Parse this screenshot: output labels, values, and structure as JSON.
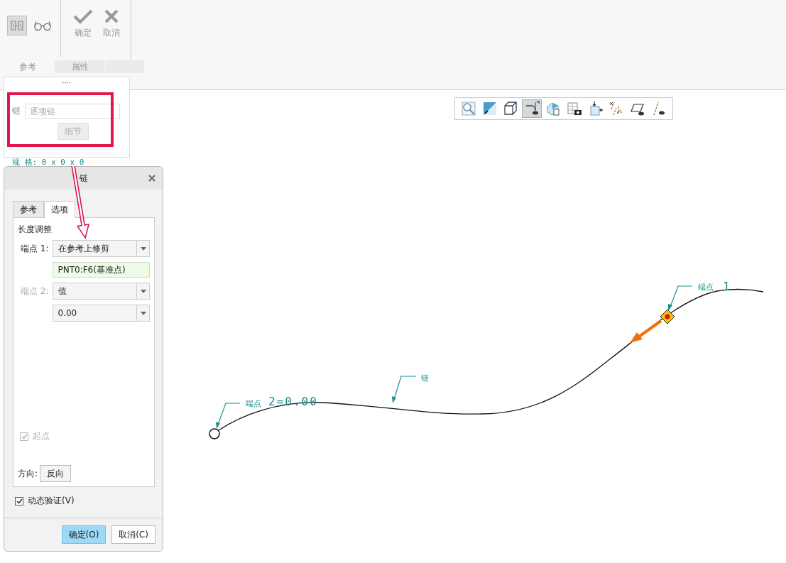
{
  "ribbon": {
    "tools": [
      {
        "kind": "chain-box",
        "selected": true
      },
      {
        "kind": "glasses",
        "selected": false
      }
    ],
    "actions": [
      {
        "kind": "ok",
        "label": "确定"
      },
      {
        "kind": "cancel",
        "label": "取消"
      }
    ],
    "tabs": [
      {
        "label": "参考",
        "selected": true
      },
      {
        "label": "属性",
        "selected": false
      }
    ]
  },
  "popup": {
    "label": "链",
    "placeholder": "逐项链",
    "button": "细节",
    "button_disabled": true
  },
  "spec_text": "规 格: 0 x 0 x 0",
  "dialog": {
    "title": "链",
    "tabs": [
      {
        "label": "参考",
        "selected": false
      },
      {
        "label": "选项",
        "selected": true
      }
    ],
    "section": "长度调整",
    "rows": [
      {
        "kind": "select",
        "label": "端点 1:",
        "label_disabled": false,
        "value": "在参考上修剪"
      },
      {
        "kind": "reference",
        "value": "PNT0:F6(基准点)"
      },
      {
        "kind": "select",
        "label": "端点 2:",
        "label_disabled": true,
        "value": "值"
      },
      {
        "kind": "select",
        "value": "0.00"
      }
    ],
    "start_point": {
      "label": "起点",
      "checked": true,
      "disabled": true
    },
    "direction": {
      "label": "方向:",
      "button": "反向"
    },
    "dynamic": {
      "label": "动态验证(V)",
      "checked": true
    },
    "buttons": [
      {
        "label": "确定(O)",
        "primary": true
      },
      {
        "label": "取消(C)",
        "primary": false
      }
    ]
  },
  "view_toolbar": [
    {
      "kind": "zoom",
      "selected": false
    },
    {
      "kind": "shade",
      "selected": false
    },
    {
      "kind": "cube",
      "selected": false
    },
    {
      "kind": "section",
      "selected": true
    },
    {
      "kind": "saved",
      "selected": false
    },
    {
      "kind": "table",
      "selected": false
    },
    {
      "kind": "move",
      "selected": false
    },
    {
      "kind": "axes",
      "selected": false
    },
    {
      "kind": "plane",
      "selected": false
    },
    {
      "kind": "axis",
      "selected": false
    }
  ],
  "canvas": {
    "labels": [
      {
        "kind": "endpoint1",
        "name": "端点",
        "value": "1"
      },
      {
        "kind": "endpoint2",
        "name": "端点",
        "value": "2=0.00"
      },
      {
        "kind": "chain",
        "name": "链"
      }
    ]
  }
}
